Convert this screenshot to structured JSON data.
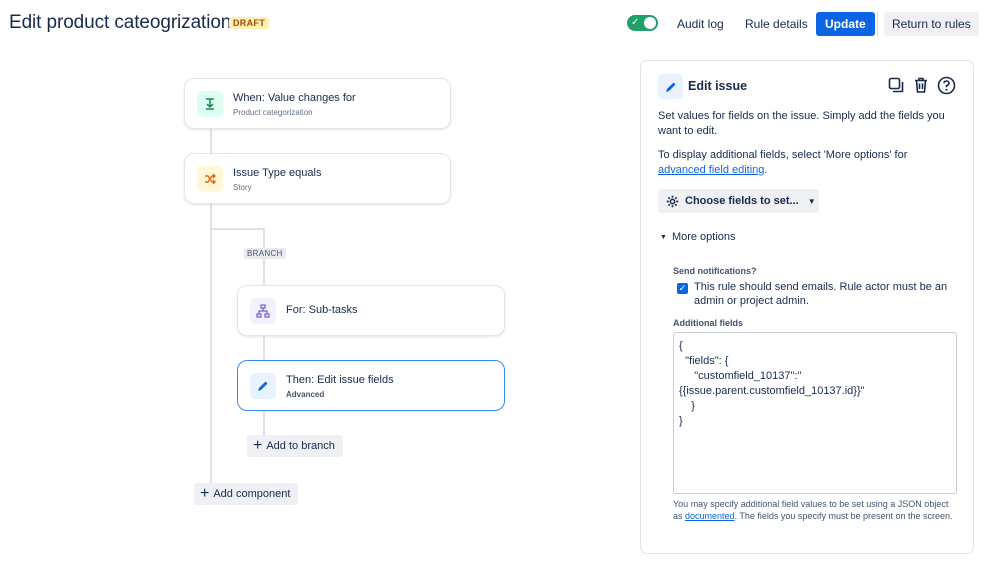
{
  "header": {
    "title": "Edit product cateogrization",
    "badge": "DRAFT",
    "toggle_on": true,
    "audit_log": "Audit log",
    "rule_details": "Rule details",
    "update": "Update",
    "return_to_rules": "Return to rules"
  },
  "flow": {
    "trigger": {
      "title": "When: Value changes for",
      "subtitle": "Product categorization",
      "icon": "value-change-icon"
    },
    "condition": {
      "title": "Issue Type equals",
      "subtitle": "Story",
      "icon": "shuffle-icon"
    },
    "branch_tag": "BRANCH",
    "branch": {
      "title": "For: Sub-tasks",
      "icon": "hierarchy-icon"
    },
    "action": {
      "title": "Then: Edit issue fields",
      "subtitle": "Advanced",
      "icon": "pencil-icon"
    },
    "add_to_branch": "Add to branch",
    "add_component": "Add component"
  },
  "panel": {
    "title": "Edit issue",
    "description": "Set values for fields on the issue. Simply add the fields you want to edit.",
    "more_fields_text": "To display additional fields, select 'More options' for",
    "more_fields_link": "advanced field editing",
    "more_fields_end": ".",
    "choose_fields": "Choose fields to set...",
    "more_options": "More options",
    "send_notifications_label": "Send notifications?",
    "send_notifications_text": "This rule should send emails. Rule actor must be an admin or project admin.",
    "send_notifications_checked": true,
    "additional_fields_label": "Additional fields",
    "additional_fields_value": "{\n  \"fields\": {\n     \"customfield_10137\":\"\n{{issue.parent.customfield_10137.id}}\"\n    }\n}",
    "helper_before": "You may specify additional field values to be set using a JSON object as ",
    "helper_link": "documented",
    "helper_after": ". The fields you specify must be present on the screen."
  },
  "colors": {
    "primary": "#0c66e4",
    "toggle": "#22a06b",
    "draft_bg": "#fff0b3",
    "trigger_icon_bg": "#dcfff1",
    "condition_icon_bg": "#fff7d6",
    "branch_icon_bg": "#f3f0ff",
    "action_icon_bg": "#e9f2ff"
  }
}
